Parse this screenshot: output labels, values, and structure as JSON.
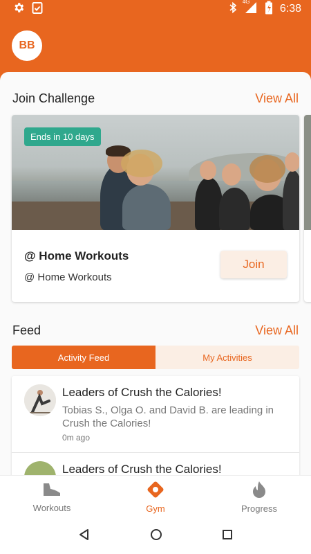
{
  "status_bar": {
    "time": "6:38",
    "network": "4G"
  },
  "header": {
    "avatar_initials": "BB"
  },
  "join_challenge": {
    "title": "Join Challenge",
    "view_all": "View All",
    "card": {
      "badge": "Ends in 10 days",
      "title": "@ Home Workouts",
      "subtitle": "@ Home Workouts",
      "join_label": "Join"
    }
  },
  "feed": {
    "title": "Feed",
    "view_all": "View All",
    "tabs": [
      {
        "label": "Activity Feed",
        "active": true
      },
      {
        "label": "My Activities",
        "active": false
      }
    ],
    "items": [
      {
        "title": "Leaders of Crush the Calories!",
        "text": "Tobias S., Olga O. and David B. are leading in Crush the Calories!",
        "time": "0m ago"
      },
      {
        "title": "Leaders of Crush the Calories!",
        "text": "",
        "time": ""
      }
    ]
  },
  "bottom_nav": {
    "items": [
      {
        "label": "Workouts",
        "icon": "shoe-icon",
        "active": false
      },
      {
        "label": "Gym",
        "icon": "location-pin-icon",
        "active": true
      },
      {
        "label": "Progress",
        "icon": "flame-icon",
        "active": false
      }
    ]
  },
  "colors": {
    "accent": "#e8661f",
    "badge": "#2fa88d",
    "tab_inactive_bg": "#fbeee4"
  }
}
